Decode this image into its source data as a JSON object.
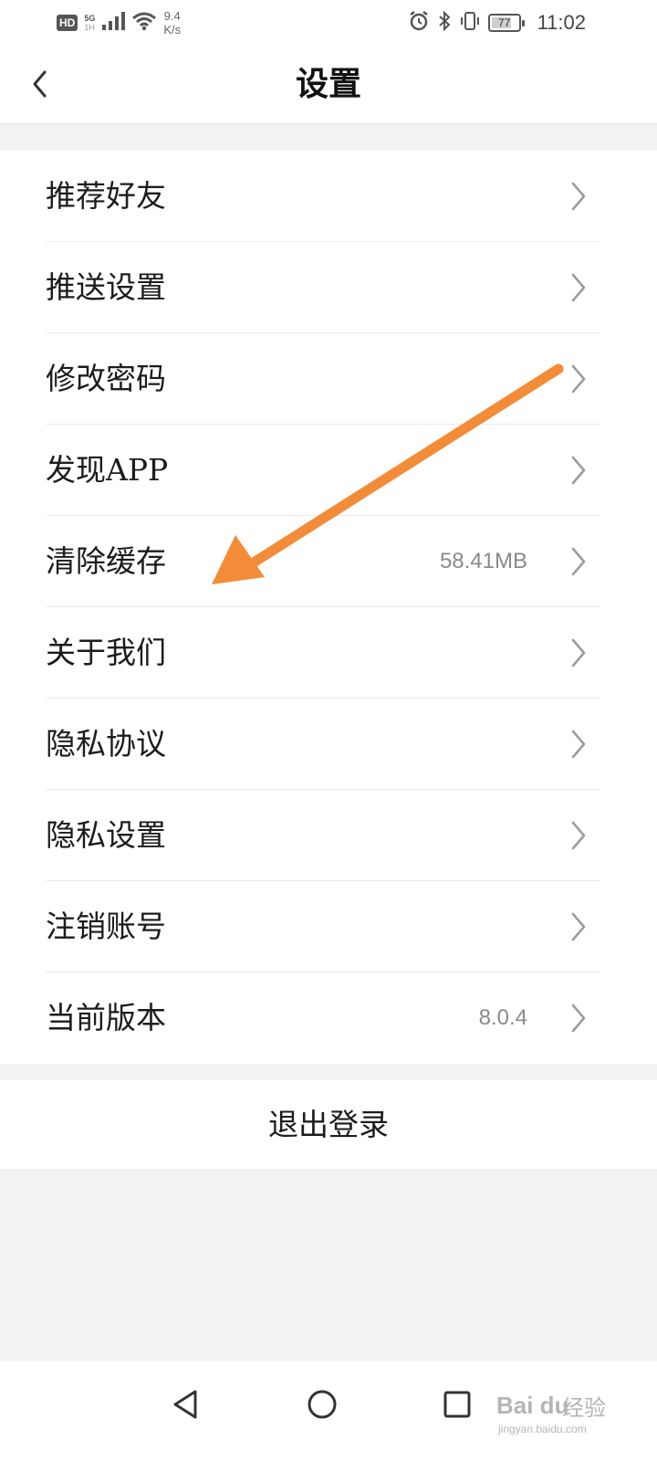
{
  "status_bar": {
    "hd_badge": "HD",
    "network_type": "5G",
    "network_sub": "1H",
    "speed_value": "9.4",
    "speed_unit": "K/s",
    "battery_level": 77,
    "battery_label": "77",
    "time": "11:02",
    "icons": [
      "signal-icon",
      "wifi-icon",
      "alarm-icon",
      "bluetooth-icon",
      "vibrate-icon",
      "battery-icon"
    ]
  },
  "header": {
    "title": "设置",
    "back_icon": "chevron-left-icon"
  },
  "settings": {
    "items": [
      {
        "label": "推荐好友",
        "value": ""
      },
      {
        "label": "推送设置",
        "value": ""
      },
      {
        "label": "修改密码",
        "value": ""
      },
      {
        "label": "发现APP",
        "value": ""
      },
      {
        "label": "清除缓存",
        "value": "58.41MB"
      },
      {
        "label": "关于我们",
        "value": ""
      },
      {
        "label": "隐私协议",
        "value": ""
      },
      {
        "label": "隐私设置",
        "value": ""
      },
      {
        "label": "注销账号",
        "value": ""
      },
      {
        "label": "当前版本",
        "value": "8.0.4"
      }
    ]
  },
  "logout": {
    "label": "退出登录"
  },
  "nav_bar": {
    "icons": [
      "nav-back-icon",
      "nav-home-icon",
      "nav-recent-icon"
    ]
  },
  "watermark": {
    "brand": "Bai du",
    "brand_suffix": "经验",
    "url": "jingyan.baidu.com"
  },
  "colors": {
    "background": "#f2f2f2",
    "surface": "#ffffff",
    "text": "#1c1c1c",
    "secondary_text": "#8a8a8a",
    "chevron": "#9a9a9a",
    "annotation_arrow": "#f28c38"
  }
}
